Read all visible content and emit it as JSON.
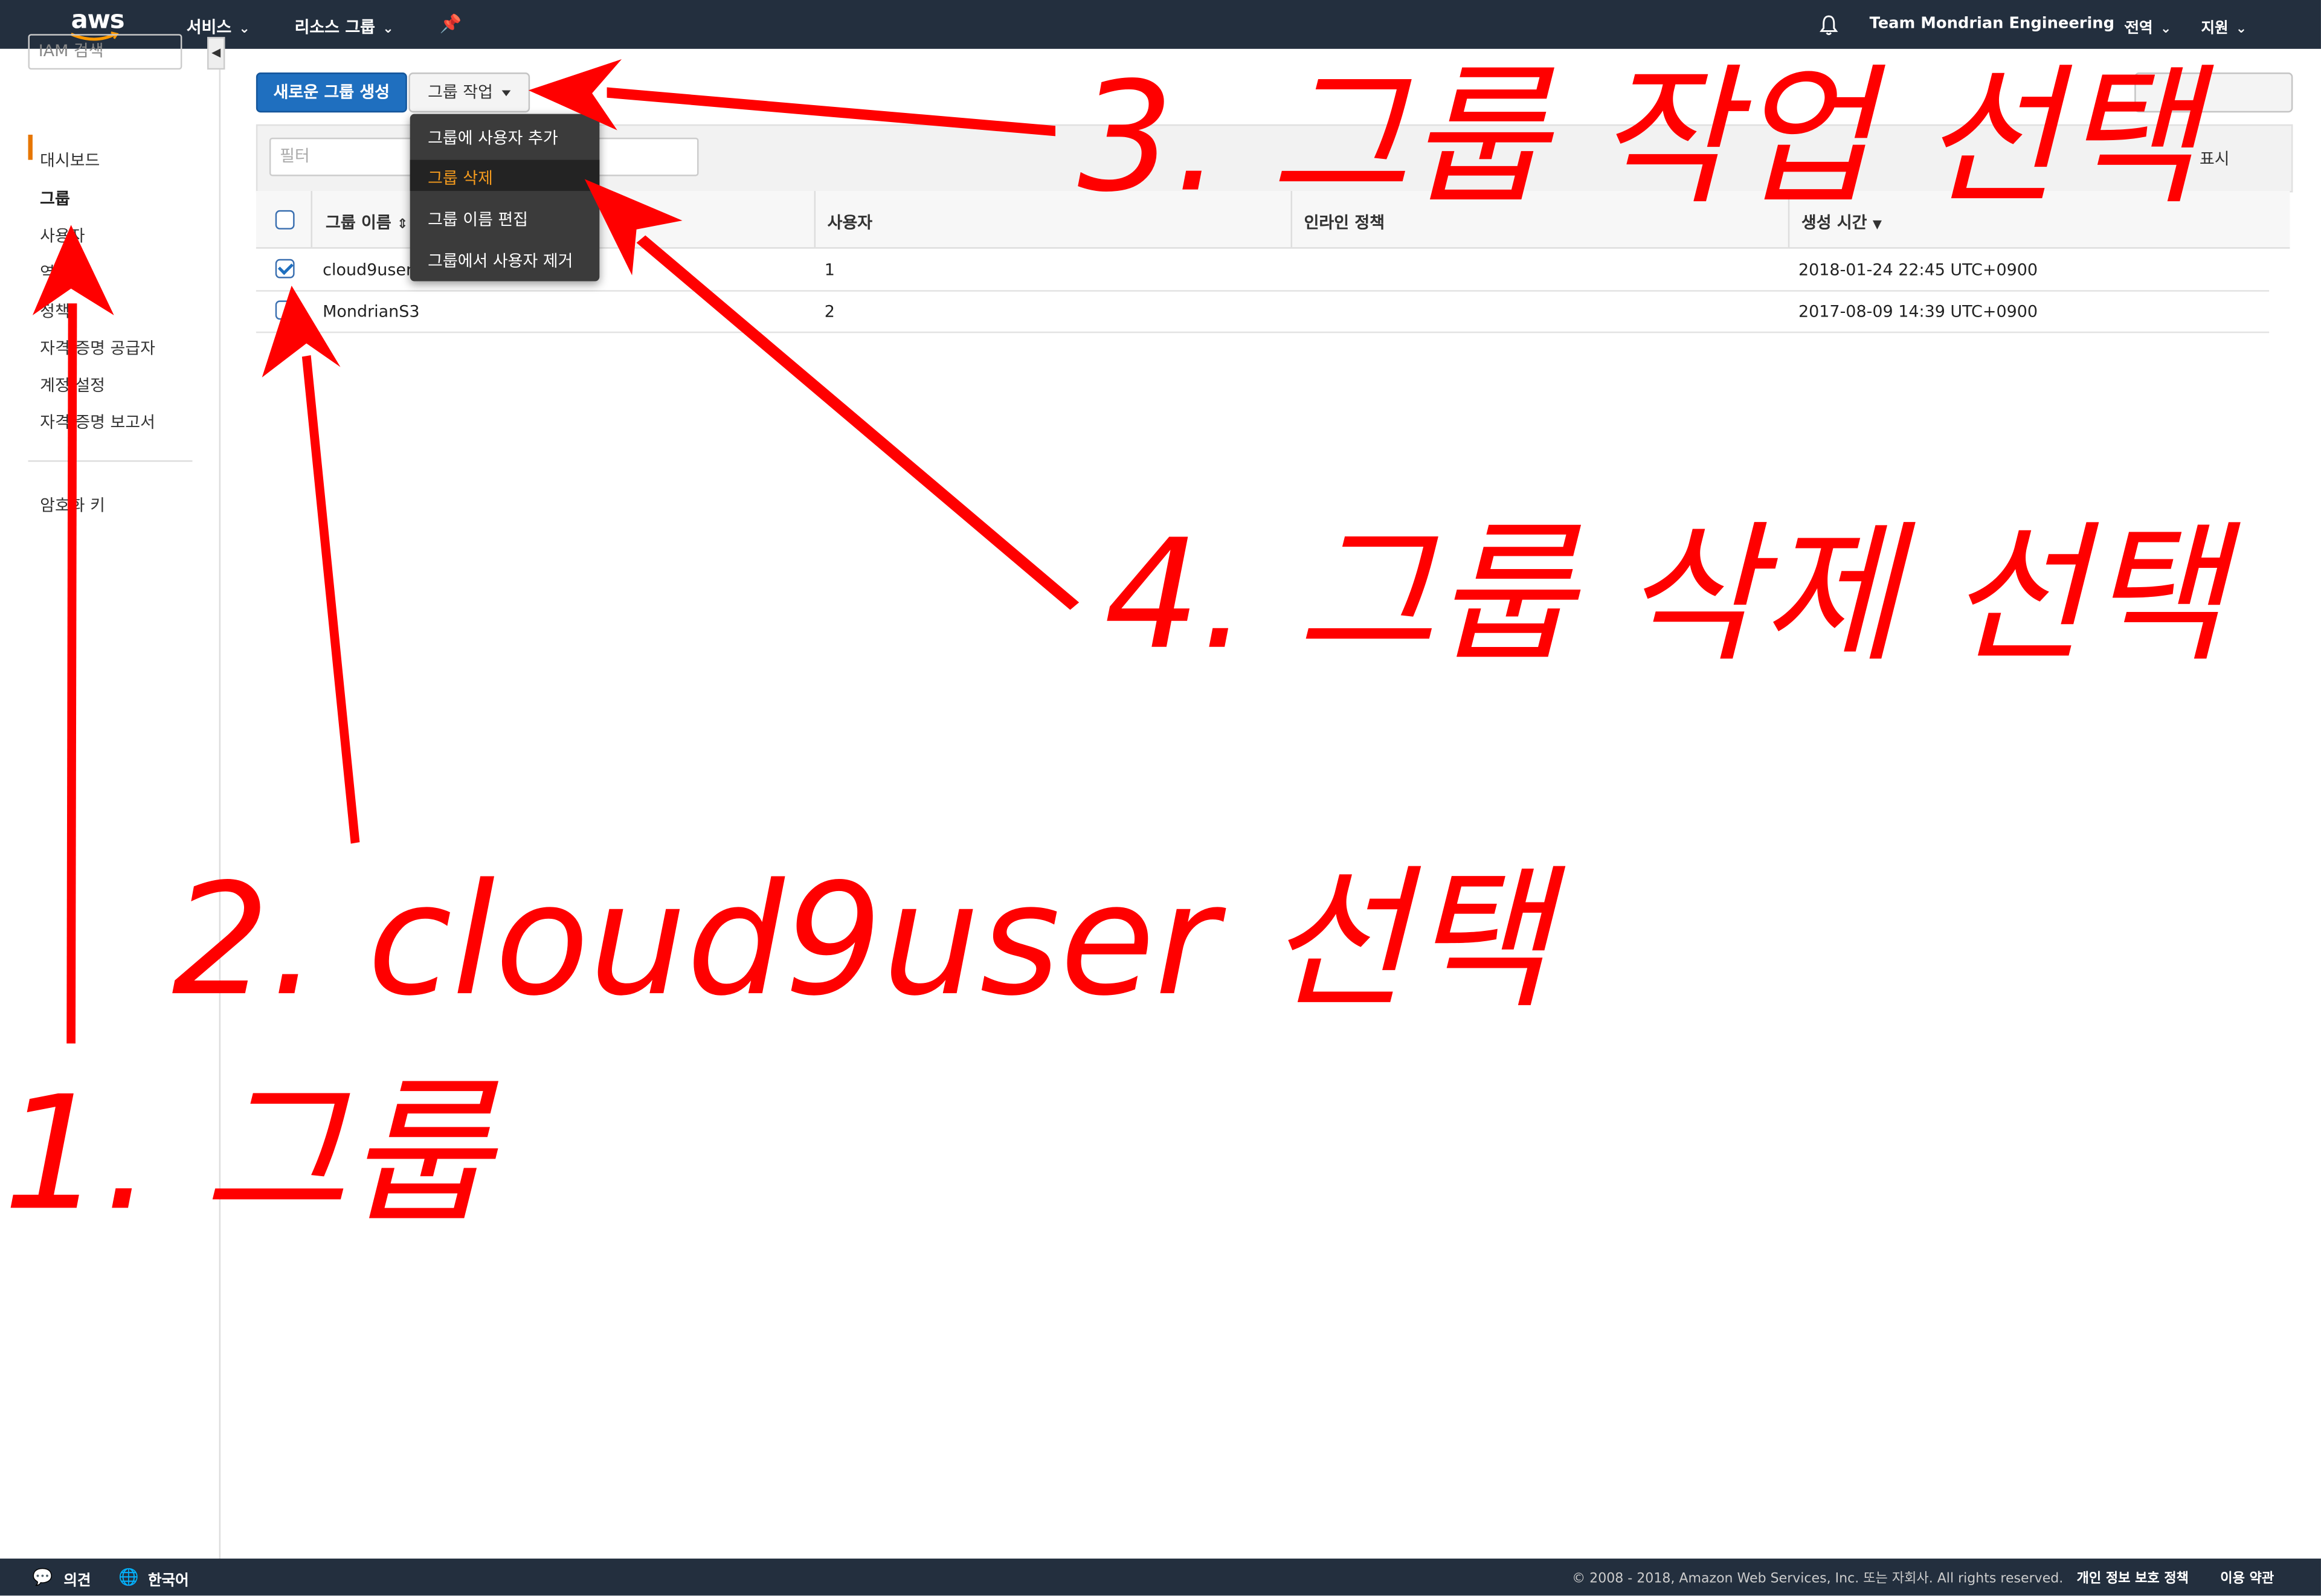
{
  "topnav": {
    "logo": "aws",
    "services": "서비스",
    "resource_groups": "리소스 그룹",
    "pin_icon": "pin-icon",
    "bell_icon": "bell-icon",
    "account": "Team Mondrian Engineering",
    "region": "전역",
    "support": "지원"
  },
  "sidebar": {
    "search_placeholder": "IAM 검색",
    "items": [
      {
        "label": "대시보드"
      },
      {
        "label": "그룹"
      },
      {
        "label": "사용자"
      },
      {
        "label": "역할"
      },
      {
        "label": "정책"
      },
      {
        "label": "자격 증명 공급자"
      },
      {
        "label": "계정 설정"
      },
      {
        "label": "자격 증명 보고서"
      },
      {
        "label": "암호화 키"
      }
    ]
  },
  "toolbar": {
    "create_group": "새로운 그룹 생성",
    "group_actions": "그룹 작업",
    "filter_placeholder": "필터",
    "display": "표시"
  },
  "dropdown": {
    "items": [
      {
        "label": "그룹에 사용자 추가"
      },
      {
        "label": "그룹 삭제"
      },
      {
        "label": "그룹 이름 편집"
      },
      {
        "label": "그룹에서 사용자 제거"
      }
    ]
  },
  "table": {
    "headers": [
      "그룹 이름",
      "사용자",
      "인라인 정책",
      "생성 시간"
    ],
    "rows": [
      {
        "name": "cloud9user",
        "users": "1",
        "created": "2018-01-24 22:45 UTC+0900",
        "checked": true
      },
      {
        "name": "MondrianS3",
        "users": "2",
        "created": "2017-08-09 14:39 UTC+0900",
        "checked": false
      }
    ]
  },
  "footer": {
    "feedback": "의견",
    "language": "한국어",
    "copyright": "© 2008 - 2018, Amazon Web Services, Inc. 또는 자회사. All rights reserved.",
    "privacy": "개인 정보 보호 정책",
    "terms": "이용 약관"
  },
  "annotations": {
    "step1": "1. 그룹",
    "step2": "2. cloud9user 선택",
    "step3": "3. 그룹 작업 선택",
    "step4": "4. 그룹 삭제 선택",
    "color": "#ff0000"
  }
}
